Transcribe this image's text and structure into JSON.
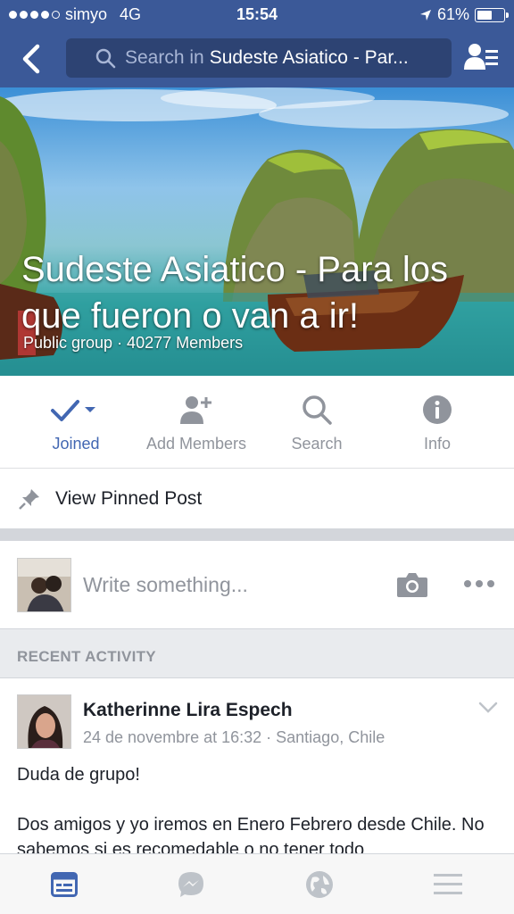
{
  "status_bar": {
    "carrier": "simyo",
    "network": "4G",
    "time": "15:54",
    "battery": "61%",
    "battery_level": 0.61
  },
  "nav": {
    "search_placeholder": "Search in",
    "search_group": "Sudeste Asiatico - Par..."
  },
  "cover": {
    "title": "Sudeste Asiatico - Para los que fueron o van a ir!",
    "subtitle": "Public group · 40277 Members"
  },
  "actions": {
    "joined": "Joined",
    "add_members": "Add Members",
    "search": "Search",
    "info": "Info"
  },
  "pinned": {
    "label": "View Pinned Post"
  },
  "composer": {
    "placeholder": "Write something..."
  },
  "recent": {
    "label": "RECENT ACTIVITY"
  },
  "post": {
    "author": "Katherinne Lira Espech",
    "meta": "24 de novembre at 16:32 · Santiago, Chile",
    "paragraph1": "Duda de grupo!",
    "paragraph2": "Dos amigos y yo iremos en Enero Febrero desde Chile. No sabemos si es recomedable o no tener todo"
  },
  "colors": {
    "brand": "#3b5998",
    "accent": "#4267b2",
    "muted": "#90949c"
  }
}
